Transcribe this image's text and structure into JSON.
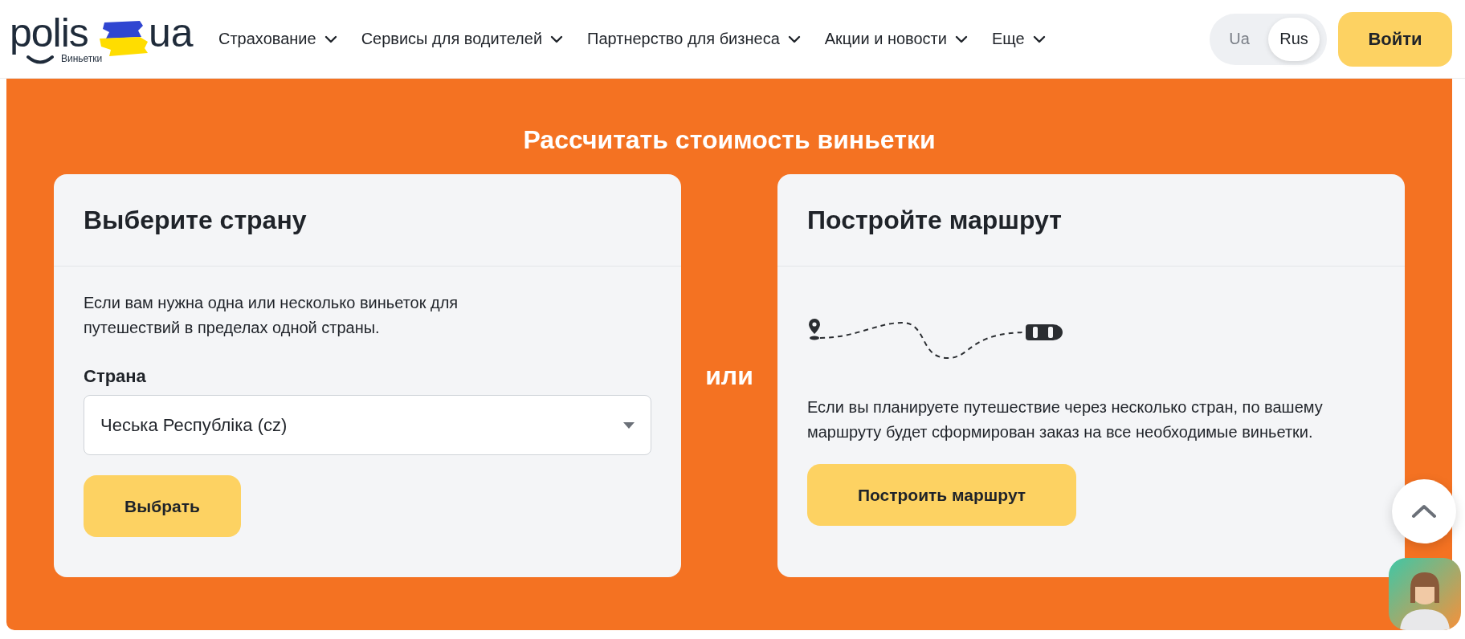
{
  "header": {
    "logo": {
      "brand": "polis",
      "domain": "ua",
      "subtitle": "Виньетки"
    },
    "nav": [
      {
        "label": "Страхование"
      },
      {
        "label": "Сервисы для водителей"
      },
      {
        "label": "Партнерство для бизнеса"
      },
      {
        "label": "Акции и новости"
      },
      {
        "label": "Еще"
      }
    ],
    "languages": [
      {
        "label": "Ua",
        "selected": false
      },
      {
        "label": "Rus",
        "selected": true
      }
    ],
    "login_button": "Войти"
  },
  "calculator": {
    "title": "Рассчитать стоимость виньетки",
    "separator": "или",
    "country_card": {
      "title": "Выберите страну",
      "description": "Если вам нужна одна или несколько виньеток для путешествий в пределах одной страны.",
      "field_label": "Страна",
      "select": {
        "value": "Чеська Республіка (cz)"
      },
      "button": "Выбрать"
    },
    "route_card": {
      "title": "Постройте маршрут",
      "description": "Если вы планируете путешествие через несколько стран, по вашему маршруту будет сформирован заказ на все необходимые виньетки.",
      "button": "Построить маршрут"
    }
  }
}
